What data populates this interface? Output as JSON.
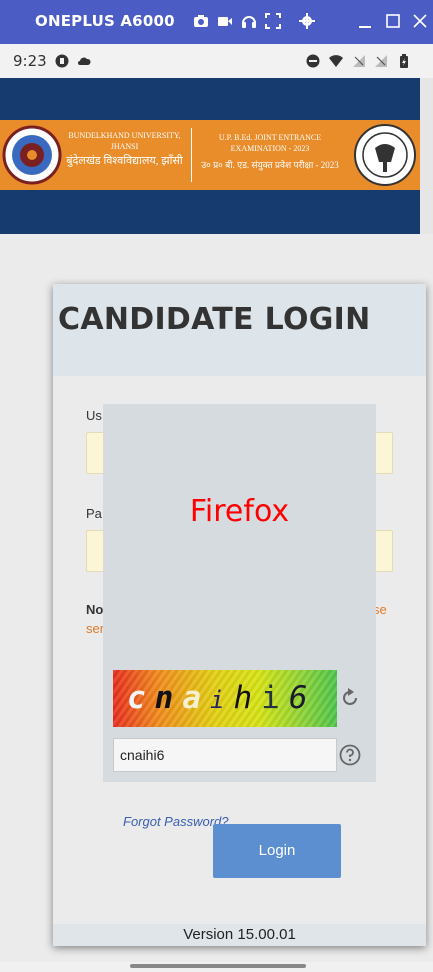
{
  "emulator": {
    "title": "ONEPLUS A6000",
    "icons": [
      "camera-icon",
      "video-icon",
      "headphones-icon",
      "fullscreen-icon",
      "settings-icon",
      "minimize-icon",
      "maximize-icon",
      "close-icon"
    ]
  },
  "status_bar": {
    "time": "9:23",
    "icons": [
      "app-notification-icon",
      "cloud-icon",
      "do-not-disturb-icon",
      "wifi-icon",
      "signal-icon",
      "signal-icon",
      "battery-icon"
    ]
  },
  "banner": {
    "university_name": "BUNDELKHAND UNIVERSITY, JHANSI",
    "university_name_hi": "बुंदेलखंड विश्वविद्यालय, झाँसी",
    "exam_name": "U.P. B.Ed. JOINT ENTRANCE EXAMINATION - 2023",
    "exam_name_hi": "उ० प्र० बी. एड. संयुक्त प्रवेश परीक्षा - 2023"
  },
  "login": {
    "title": "CANDIDATE LOGIN",
    "username_label": "Us",
    "password_label": "Pa",
    "note_label": "No",
    "note_tail_1": "se",
    "note_tail_2": "ser",
    "forgot_password": "Forgot Password?",
    "login_button": "Login",
    "version": "Version 15.00.01"
  },
  "overlay": {
    "label": "Firefox",
    "captcha_chars": [
      "c",
      "n",
      "a",
      "i",
      "h",
      "i",
      "6"
    ],
    "captcha_input_value": "cnaihi6"
  },
  "colors": {
    "title_bar": "#4b5cc4",
    "banner_navy": "#163b6e",
    "banner_orange": "#e98c2a",
    "login_button": "#5b8fd0",
    "firefox_label": "#ff0000"
  }
}
